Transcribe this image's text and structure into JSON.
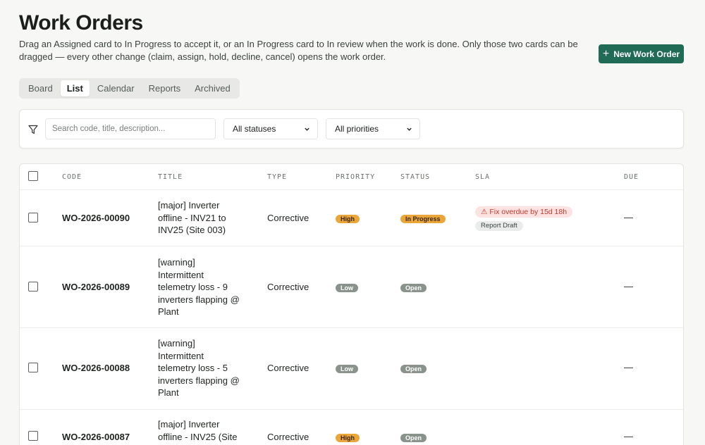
{
  "header": {
    "title": "Work Orders",
    "description": "Drag an Assigned card to In Progress to accept it, or an In Progress card to In review when the work is done. Only those two cards can be dragged — every other change (claim, assign, hold, decline, cancel) opens the work order.",
    "new_button": "New Work Order"
  },
  "tabs": [
    {
      "label": "Board"
    },
    {
      "label": "List",
      "active": true
    },
    {
      "label": "Calendar"
    },
    {
      "label": "Reports"
    },
    {
      "label": "Archived"
    }
  ],
  "filters": {
    "search_placeholder": "Search code, title, description...",
    "status_select": "All statuses",
    "priority_select": "All priorities"
  },
  "table": {
    "columns": [
      "CODE",
      "TITLE",
      "TYPE",
      "PRIORITY",
      "STATUS",
      "SLA",
      "DUE"
    ],
    "rows": [
      {
        "code": "WO-2026-00090",
        "title_lines": [
          "[major] Inverter",
          "offline - INV21 to",
          "INV25 (Site 003)"
        ],
        "type": "Corrective",
        "priority": "High",
        "status": "In Progress",
        "sla_overdue": "⚠ Fix overdue by 15d 18h",
        "sla_draft": "Report Draft",
        "due": "—"
      },
      {
        "code": "WO-2026-00089",
        "title_lines": [
          "[warning]",
          "Intermittent",
          "telemetry loss - 9",
          "inverters flapping @",
          "Plant"
        ],
        "type": "Corrective",
        "priority": "Low",
        "status": "Open",
        "due": "—"
      },
      {
        "code": "WO-2026-00088",
        "title_lines": [
          "[warning]",
          "Intermittent",
          "telemetry loss - 5",
          "inverters flapping @",
          "Plant"
        ],
        "type": "Corrective",
        "priority": "Low",
        "status": "Open",
        "due": "—"
      },
      {
        "code": "WO-2026-00087",
        "title_lines": [
          "[major] Inverter",
          "offline - INV25 (Site"
        ],
        "type": "Corrective",
        "priority": "High",
        "status": "Open",
        "due": "—"
      }
    ]
  },
  "colors": {
    "accent": "#1f6b55",
    "high": "#eba63a",
    "low": "#8a928c",
    "overdue_text": "#c0392b"
  }
}
